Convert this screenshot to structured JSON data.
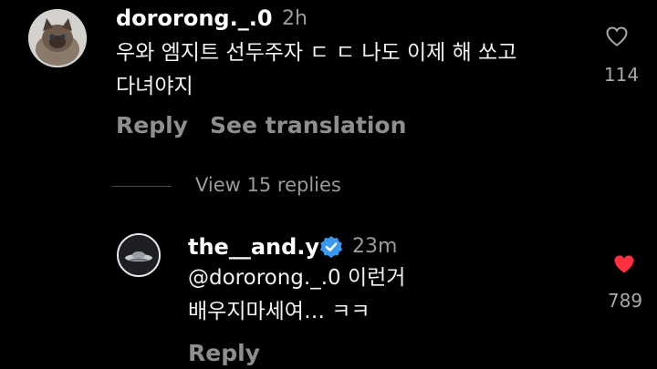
{
  "comments": [
    {
      "username": "dororong._.0",
      "time": "2h",
      "lines": [
        "우와 엠지트 선두주자 ㄷ ㄷ 나도 이제 해 쏘고",
        "다녀야지"
      ],
      "reply_label": "Reply",
      "translate_label": "See translation",
      "like_count": "114",
      "liked": false,
      "avatar_icon": "cat-avatar"
    },
    {
      "username": "the__and.y",
      "verified": true,
      "time": "23m",
      "lines": [
        "@dororong._.0 이런거",
        "배우지마세여… ㅋㅋ"
      ],
      "reply_label": "Reply",
      "like_count": "789",
      "liked": true,
      "avatar_icon": "ufo-avatar"
    }
  ],
  "view_replies_label": "View 15 replies",
  "colors": {
    "background": "#000000",
    "liked_heart": "#ff3040",
    "verified_badge": "#3897f0",
    "muted_text": "#8e8e8e"
  }
}
